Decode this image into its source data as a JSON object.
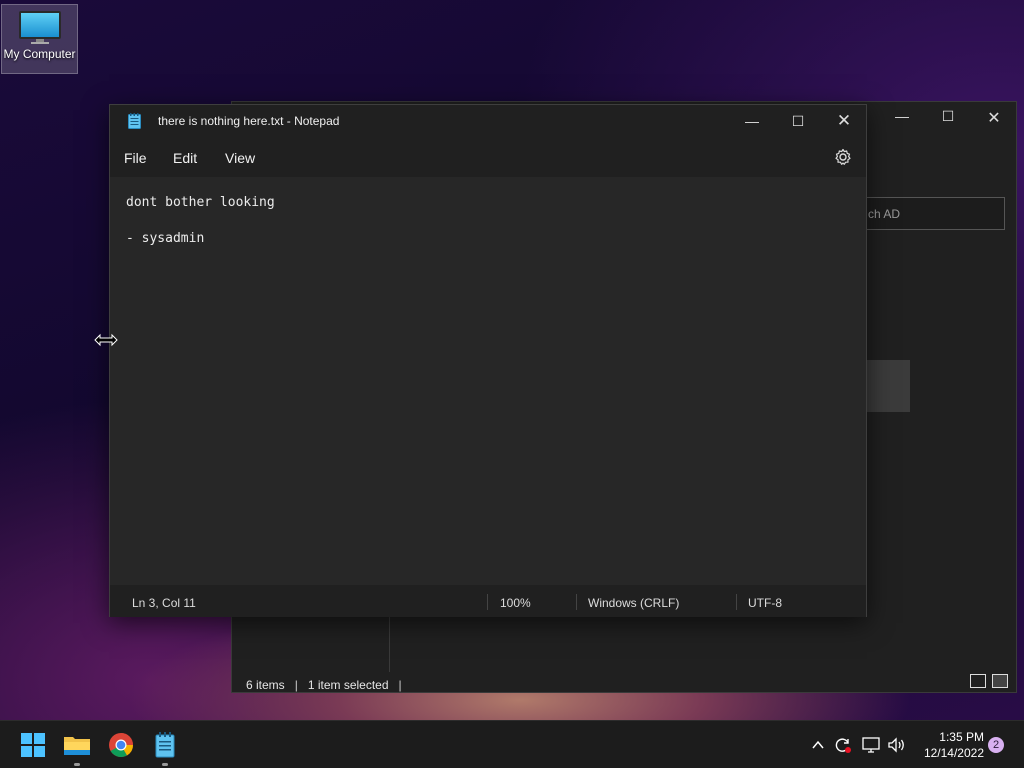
{
  "desktop": {
    "icons": [
      {
        "label": "My Computer",
        "icon": "computer-icon"
      }
    ]
  },
  "explorer": {
    "search_placeholder": "ch AD",
    "status": {
      "items_count": "6 items",
      "selected": "1 item selected"
    },
    "controls": {
      "minimize": "—",
      "maximize": "☐",
      "close": "✕"
    }
  },
  "notepad": {
    "title": "there is nothing here.txt - Notepad",
    "controls": {
      "minimize": "—",
      "maximize": "☐",
      "close": "✕"
    },
    "menu": {
      "file": "File",
      "edit": "Edit",
      "view": "View"
    },
    "content_lines": [
      "dont bother looking",
      "",
      "- sysadmin"
    ],
    "status": {
      "position": "Ln 3, Col 11",
      "zoom": "100%",
      "line_ending": "Windows (CRLF)",
      "encoding": "UTF-8"
    }
  },
  "taskbar": {
    "apps": [
      "start-icon",
      "file-explorer-icon",
      "chrome-icon",
      "notepad-icon"
    ],
    "clock": {
      "time": "1:35 PM",
      "date": "12/14/2022"
    },
    "notification_count": "2"
  },
  "colors": {
    "window_bg": "#202020",
    "editor_bg": "#272727",
    "taskbar_bg": "#1c1c1c",
    "accent": "#0078d4"
  }
}
